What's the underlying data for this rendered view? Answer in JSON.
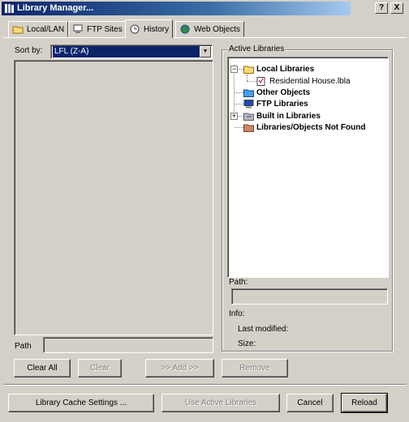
{
  "window": {
    "title": "Library Manager...",
    "help_label": "?",
    "close_label": "X"
  },
  "tabs": [
    {
      "label": "Local/LAN",
      "icon": "folder-icon"
    },
    {
      "label": "FTP Sites",
      "icon": "ftp-icon"
    },
    {
      "label": "History",
      "icon": "history-icon"
    },
    {
      "label": "Web Objects",
      "icon": "globe-icon"
    }
  ],
  "sort": {
    "label": "Sort by:",
    "value": "LFL (Z-A)"
  },
  "left_path_label": "Path",
  "active_libraries": {
    "label": "Active Libraries",
    "tree": [
      {
        "label": "Local Libraries",
        "icon": "folder-icon",
        "bold": true
      },
      {
        "label": "Residential House.lbla",
        "icon": "library-file-icon",
        "bold": false
      },
      {
        "label": "Other Objects",
        "icon": "objects-icon",
        "bold": true
      },
      {
        "label": "FTP Libraries",
        "icon": "ftp-computer-icon",
        "bold": true
      },
      {
        "label": "Built in Libraries",
        "icon": "built-in-library-icon",
        "bold": true
      },
      {
        "label": "Libraries/Objects Not Found",
        "icon": "not-found-icon",
        "bold": true
      }
    ],
    "path_label": "Path:",
    "info_label": "Info:",
    "modified_label": "Last modified:",
    "size_label": "Size:"
  },
  "buttons": {
    "clear_all": "Clear All",
    "clear": "Clear",
    "add": ">> Add >>",
    "remove": "Remove",
    "cache_settings": "Library Cache Settings ...",
    "use_active": "Use Active Libraries",
    "cancel": "Cancel",
    "reload": "Reload"
  },
  "colors": {
    "face": "#d4d0c8",
    "title_start": "#0a246a",
    "title_end": "#a6caf0",
    "selection": "#0a246a"
  }
}
